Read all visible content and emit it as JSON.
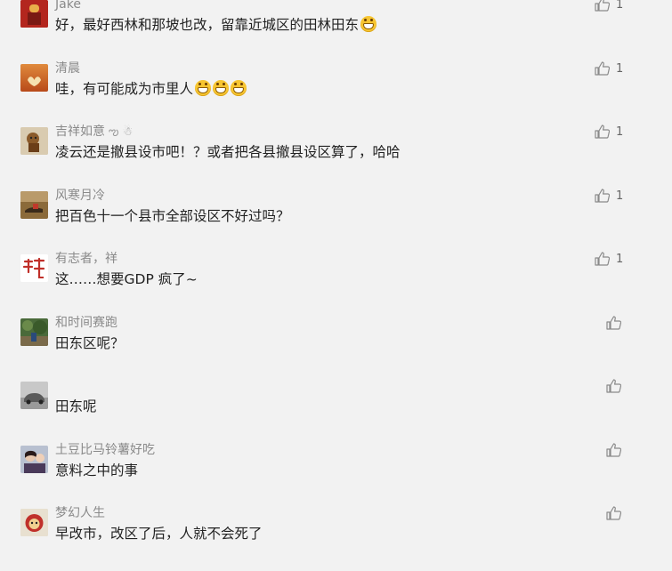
{
  "comments": [
    {
      "nickname": "Jake",
      "content": "好，最好西林和那坡也改，留靠近城区的田林田东",
      "emoji_count": 1,
      "likes": "1"
    },
    {
      "nickname": "清晨",
      "content": "哇，有可能成为市里人",
      "emoji_count": 3,
      "likes": "1"
    },
    {
      "nickname": "吉祥如意",
      "nickname_deco": "ఌ ☃",
      "content": "凌云还是撤县设市吧！？或者把各县撤县设区算了，哈哈",
      "emoji_count": 0,
      "likes": "1"
    },
    {
      "nickname": "风寒月冷",
      "content": "把百色十一个县市全部设区不好过吗？",
      "emoji_count": 0,
      "likes": "1"
    },
    {
      "nickname": "有志者，祥",
      "content": "这……想要GDP 疯了~",
      "emoji_count": 0,
      "likes": "1"
    },
    {
      "nickname": "和时间赛跑",
      "content": "田东区呢？",
      "emoji_count": 0,
      "likes": ""
    },
    {
      "nickname": "",
      "content": "田东呢",
      "emoji_count": 0,
      "likes": ""
    },
    {
      "nickname": "土豆比马铃薯好吃",
      "content": "意料之中的事",
      "emoji_count": 0,
      "likes": ""
    },
    {
      "nickname": "梦幻人生",
      "content": "早改市，改区了后，人就不会死了",
      "emoji_count": 0,
      "likes": ""
    }
  ],
  "icons": {
    "like": "thumbs-up-icon",
    "emoji": "grin-emoji-icon"
  },
  "colors": {
    "background": "#f2f2f2",
    "nickname": "#8a8a8a",
    "content": "#222222",
    "like_icon": "#8a8a8a"
  }
}
